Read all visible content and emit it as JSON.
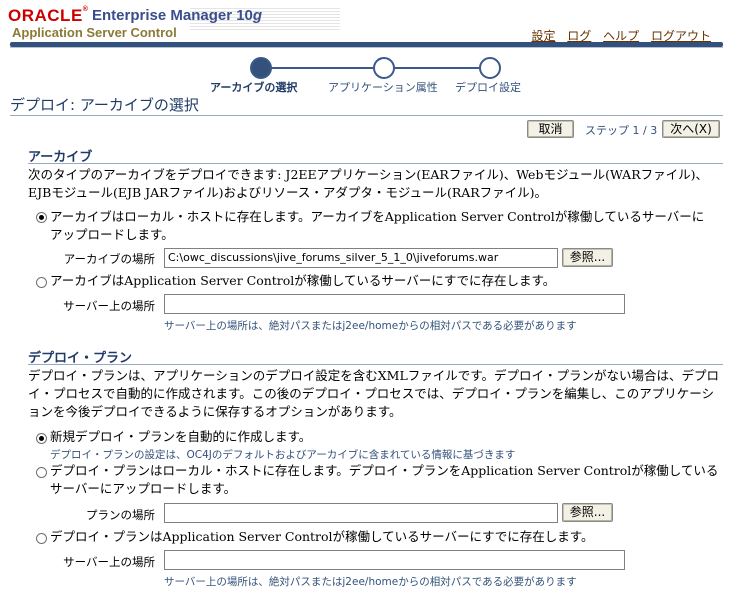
{
  "header": {
    "oracle_logo": "ORACLE",
    "product_prefix": "Enterprise Manager 10",
    "product_suffix": "g",
    "subtitle": "Application Server Control",
    "links": [
      "設定",
      "ログ",
      "ヘルプ",
      "ログアウト"
    ]
  },
  "train": {
    "steps": [
      "アーカイブの選択",
      "アプリケーション属性",
      "デプロイ設定"
    ],
    "current": 0
  },
  "page": {
    "title": "デプロイ: アーカイブの選択",
    "cancel_label": "取消",
    "step_indicator": "ステップ 1 / 3",
    "next_label": "次へ(X)"
  },
  "archive": {
    "heading": "アーカイブ",
    "description": "次のタイプのアーカイブをデプロイできます: J2EEアプリケーション(EARファイル)、Webモジュール(WARファイル)、EJBモジュール(EJB JARファイル)およびリソース・アダプタ・モジュール(RARファイル)。",
    "option_local": "アーカイブはローカル・ホストに存在します。アーカイブをApplication Server Controlが稼働しているサーバーにアップロードします。",
    "location_label": "アーカイブの場所",
    "location_value": "C:\\owc_discussions\\jive_forums_silver_5_1_0\\jiveforums.war",
    "browse_label": "参照...",
    "option_server": "アーカイブはApplication Server Controlが稼働しているサーバーにすでに存在します。",
    "server_location_label": "サーバー上の場所",
    "server_location_value": "",
    "server_hint": "サーバー上の場所は、絶対パスまたはj2ee/homeからの相対パスである必要があります"
  },
  "plan": {
    "heading": "デプロイ・プラン",
    "description": "デプロイ・プランは、アプリケーションのデプロイ設定を含むXMLファイルです。デプロイ・プランがない場合は、デプロイ・プロセスで自動的に作成されます。この後のデプロイ・プロセスでは、デプロイ・プランを編集し、このアプリケーションを今後デプロイできるように保存するオプションがあります。",
    "option_auto": "新規デプロイ・プランを自動的に作成します。",
    "auto_hint": "デプロイ・プランの設定は、OC4Jのデフォルトおよびアーカイブに含まれている情報に基づきます",
    "option_local": "デプロイ・プランはローカル・ホストに存在します。デプロイ・プランをApplication Server Controlが稼働しているサーバーにアップロードします。",
    "plan_location_label": "プランの場所",
    "plan_location_value": "",
    "browse_label": "参照...",
    "option_server": "デプロイ・プランはApplication Server Controlが稼働しているサーバーにすでに存在します。",
    "server_location_label": "サーバー上の場所",
    "server_location_value": "",
    "server_hint": "サーバー上の場所は、絶対パスまたはj2ee/homeからの相対パスである必要があります"
  }
}
